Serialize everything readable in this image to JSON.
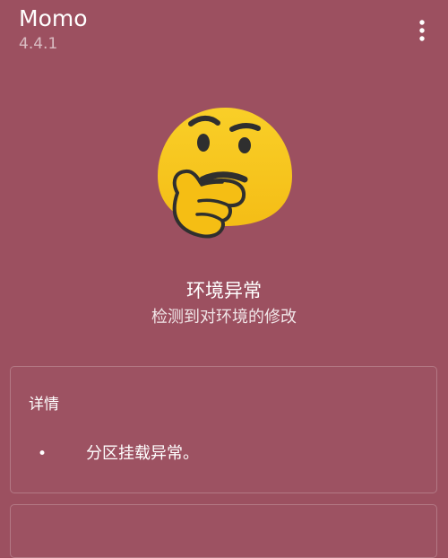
{
  "app": {
    "title": "Momo",
    "version": "4.4.1"
  },
  "toolbar": {
    "menu_icon": "more-vert-icon"
  },
  "hero": {
    "icon": "thinking-face-emoji",
    "title": "环境异常",
    "subtitle": "检测到对环境的修改"
  },
  "details": {
    "title": "详情",
    "items": [
      {
        "bullet": "•",
        "text": "分区挂载异常。"
      }
    ]
  },
  "colors": {
    "background": "#9c5060",
    "text": "#ffffff",
    "emoji_face": "#f7c61f",
    "emoji_eye": "#2f2f2f"
  }
}
